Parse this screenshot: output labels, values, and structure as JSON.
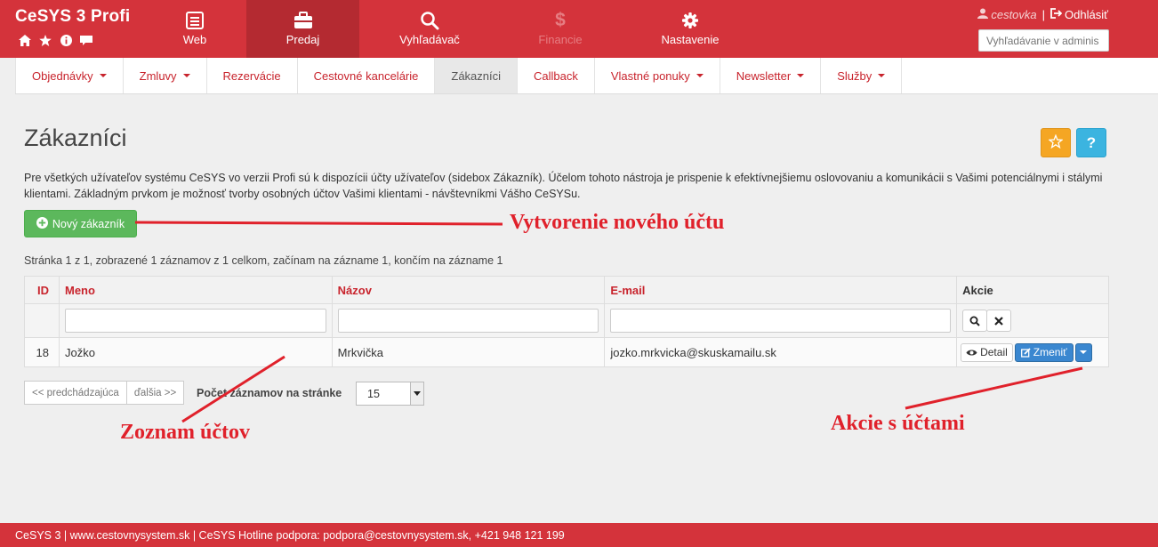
{
  "header": {
    "brand": "CeSYS 3 Profi",
    "brand_icons": [
      "home-icon",
      "star-icon",
      "info-icon",
      "comment-icon"
    ],
    "nav": [
      {
        "label": "Web",
        "icon": "list-icon"
      },
      {
        "label": "Predaj",
        "icon": "briefcase-icon",
        "active": true
      },
      {
        "label": "Vyhľadávač",
        "icon": "search-icon"
      },
      {
        "label": "Financie",
        "icon": "dollar-icon",
        "disabled": true
      },
      {
        "label": "Nastavenie",
        "icon": "gear-icon"
      }
    ],
    "user": {
      "name": "cestovka",
      "separator": "|",
      "logout": "Odhlásiť"
    },
    "admin_search_placeholder": "Vyhľadávanie v adminis"
  },
  "subnav": {
    "items": [
      {
        "label": "Objednávky",
        "dropdown": true
      },
      {
        "label": "Zmluvy",
        "dropdown": true
      },
      {
        "label": "Rezervácie",
        "dropdown": false
      },
      {
        "label": "Cestovné kancelárie",
        "dropdown": false
      },
      {
        "label": "Zákazníci",
        "dropdown": false,
        "active": true
      },
      {
        "label": "Callback",
        "dropdown": false
      },
      {
        "label": "Vlastné ponuky",
        "dropdown": true
      },
      {
        "label": "Newsletter",
        "dropdown": true
      },
      {
        "label": "Služby",
        "dropdown": true
      }
    ]
  },
  "main": {
    "title": "Zákazníci",
    "favorite_icon": "star-icon",
    "help_label": "?",
    "intro": "Pre všetkých užívateľov systému CeSYS vo verzii Profi sú k dispozícii účty užívateľov (sidebox Zákazník). Účelom tohoto nástroja je prispenie k efektívnejšiemu oslovovaniu a komunikácii s Vašimi potenciálnymi i stálymi klientami. Základným prvkom je možnosť tvorby osobných účtov Vašimi klientami - návštevníkmi Vášho CeSYSu.",
    "new_button": "Nový zákazník",
    "pager_info": "Stránka 1 z 1, zobrazené 1 záznamov z 1 celkom, začínam na zázname 1, končím na zázname 1",
    "table": {
      "columns": [
        "ID",
        "Meno",
        "Názov",
        "E-mail",
        "Akcie"
      ],
      "rows": [
        {
          "id": "18",
          "meno": "Jožko",
          "nazov": "Mrkvička",
          "email": "jozko.mrkvicka@skuskamailu.sk"
        }
      ],
      "detail_label": "Detail",
      "edit_label": "Zmeniť"
    },
    "pager": {
      "prev": "<< predchádzajúca",
      "next": "ďalšia >>",
      "per_page_label": "Počet záznamov na stránke",
      "per_page_value": "15"
    }
  },
  "annotations": {
    "new_account": "Vytvorenie nového účtu",
    "account_list": "Zoznam účtov",
    "account_actions": "Akcie s účtami",
    "color": "#e0212b"
  },
  "footer": {
    "text": "CeSYS 3 | www.cestovnysystem.sk | CeSYS Hotline podpora: podpora@cestovnysystem.sk, +421 948 121 199"
  },
  "colors": {
    "brand_red": "#d4333b",
    "active_nav": "#b42a31",
    "success": "#5cb85c",
    "primary": "#3a87d0",
    "warning": "#f5a623",
    "info": "#3bb4e0"
  }
}
